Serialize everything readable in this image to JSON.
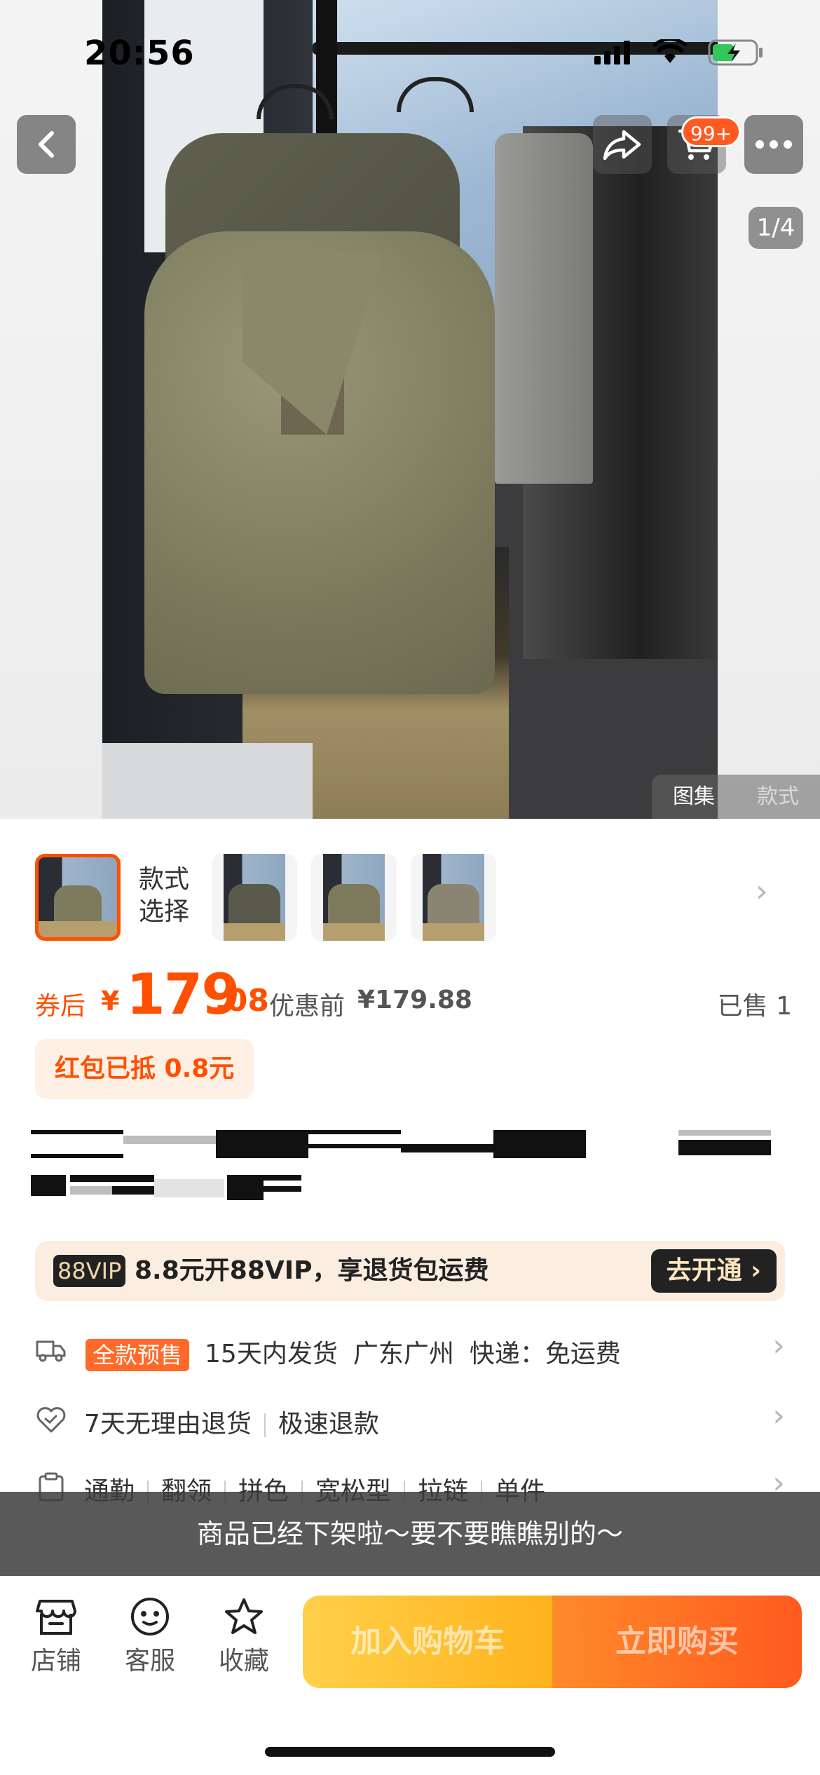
{
  "status_bar": {
    "time": "20:56"
  },
  "header": {
    "cart_badge": "99+",
    "image_pager": "1/4"
  },
  "gallery": {
    "tabs": [
      "图集",
      "款式"
    ]
  },
  "variants": {
    "label_line1": "款式",
    "label_line2": "选择"
  },
  "price": {
    "prefix": "券后",
    "currency": "¥",
    "integer": "179",
    "decimal": ".08",
    "original_label": "优惠前",
    "original": "¥179.88",
    "sold": "已售 1",
    "red_packet": "红包已抵 0.8元"
  },
  "vip": {
    "logo": "88VIP",
    "text": "8.8元开88VIP，享退货包运费",
    "button": "去开通 ›"
  },
  "shipping": {
    "badge": "全款预售",
    "items": [
      "15天内发货",
      "广东广州",
      "快递：免运费"
    ]
  },
  "service": {
    "items": [
      "7天无理由退货",
      "极速退款"
    ]
  },
  "attributes": {
    "items": [
      "通勤",
      "翻领",
      "拼色",
      "宽松型",
      "拉链",
      "单件"
    ]
  },
  "toast": "商品已经下架啦～要不要瞧瞧别的～",
  "bottom_bar": {
    "shop": "店铺",
    "service": "客服",
    "favorite": "收藏",
    "add_to_cart": "加入购物车",
    "buy_now": "立即购买"
  },
  "colors": {
    "accent": "#ff5000",
    "presale": "#ff6a2a",
    "cart_button": "#ffb21c",
    "buy_button": "#ff5a1f"
  }
}
